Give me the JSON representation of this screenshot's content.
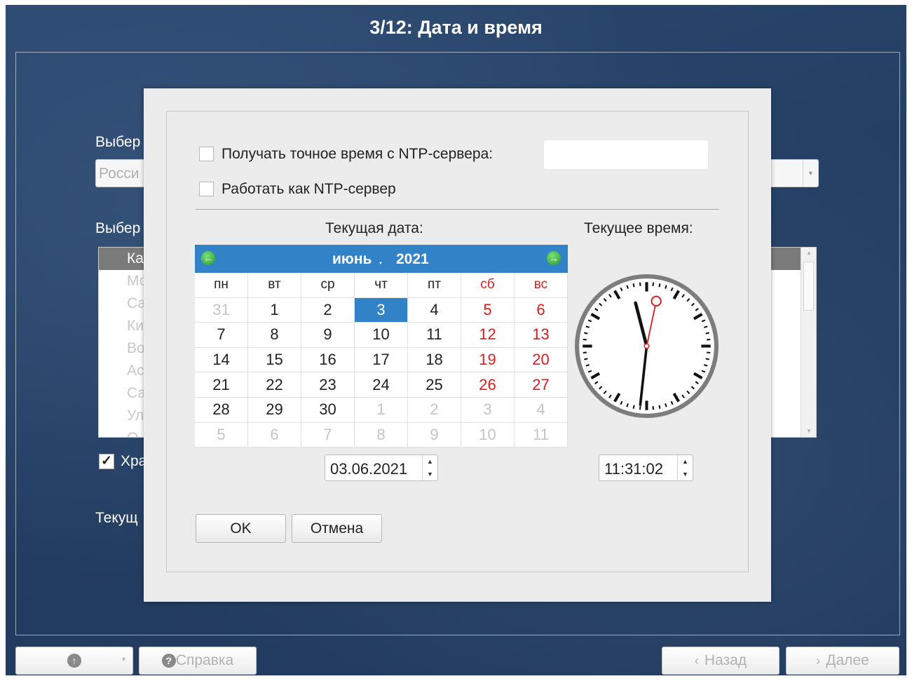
{
  "window": {
    "title": "3/12: Дата и время"
  },
  "background": {
    "label_select_region": "Выбер",
    "region_combo_value": "Росси",
    "label_select_city": "Выбер",
    "cities": [
      "Ка",
      "Мо",
      "Са",
      "Ки",
      "Во",
      "Ас",
      "Са",
      "Ул",
      "О"
    ],
    "store_checkbox_label": "Хра",
    "current_label": "Текущ"
  },
  "footer": {
    "left_icon": "settings-circle-icon",
    "help_label": "Справка",
    "back_label": "Назад",
    "next_label": "Далее"
  },
  "dialog": {
    "ntp_client_label": "Получать точное время с NTP-сервера:",
    "ntp_server_value": "",
    "ntp_server_label": "Работать как NTP-сервер",
    "current_date_label": "Текущая дата:",
    "current_time_label": "Текущее время:",
    "date_value": "03.06.2021",
    "time_value": "11:31:02",
    "ok_label": "OK",
    "cancel_label": "Отмена"
  },
  "calendar": {
    "month": "июнь",
    "year": "2021",
    "weekdays": [
      "пн",
      "вт",
      "ср",
      "чт",
      "пт",
      "сб",
      "вс"
    ],
    "weeks": [
      [
        "31",
        "1",
        "2",
        "3",
        "4",
        "5",
        "6"
      ],
      [
        "7",
        "8",
        "9",
        "10",
        "11",
        "12",
        "13"
      ],
      [
        "14",
        "15",
        "16",
        "17",
        "18",
        "19",
        "20"
      ],
      [
        "21",
        "22",
        "23",
        "24",
        "25",
        "26",
        "27"
      ],
      [
        "28",
        "29",
        "30",
        "1",
        "2",
        "3",
        "4"
      ],
      [
        "5",
        "6",
        "7",
        "8",
        "9",
        "10",
        "11"
      ]
    ],
    "selected_day": "3",
    "weekend_color": "#e01b1b",
    "accent_color": "#3182c7"
  },
  "clock": {
    "hours": 11,
    "minutes": 31,
    "seconds": 2
  }
}
